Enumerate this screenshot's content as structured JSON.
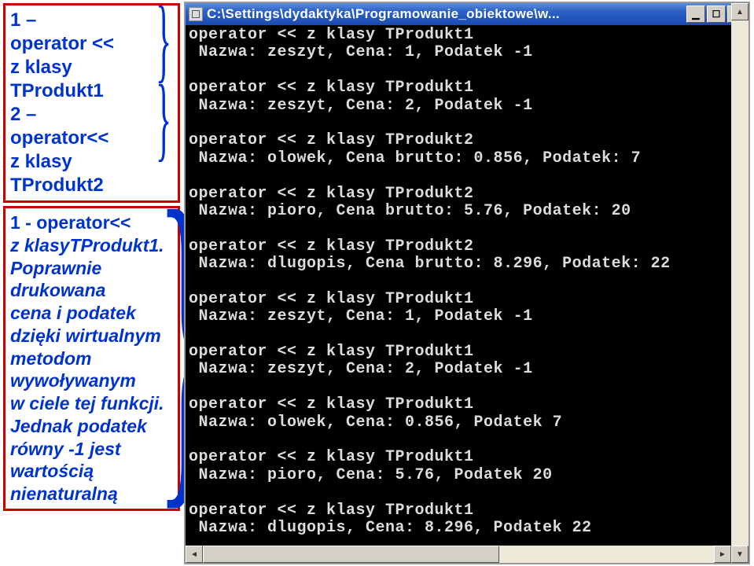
{
  "left": {
    "box1": {
      "l1": "1 –",
      "l2": "operator <<",
      "l3": "z klasy",
      "l4": "TProdukt1",
      "l5": "2 –",
      "l6": "operator<<",
      "l7": "z klasy",
      "l8": "TProdukt2"
    },
    "box2": {
      "l1": "1  - operator<<",
      "l2": "z klasyTProdukt1.",
      "l3": "Poprawnie",
      "l4": "drukowana",
      "l5": "cena i podatek",
      "l6": "dzięki wirtualnym",
      "l7": "metodom",
      "l8": "wywoływanym",
      "l9": "w ciele tej funkcji.",
      "l10": "Jednak podatek",
      "l11": "równy -1 jest",
      "l12": "wartością",
      "l13": "nienaturalną"
    }
  },
  "window": {
    "title": "C:\\Settings\\dydaktyka\\Programowanie_obiektowe\\w...",
    "buttons": {
      "min": "▁",
      "max": "☐",
      "close": "✕"
    }
  },
  "console": {
    "lines": [
      "operator << z klasy TProdukt1",
      " Nazwa: zeszyt, Cena: 1, Podatek -1",
      "",
      "operator << z klasy TProdukt1",
      " Nazwa: zeszyt, Cena: 2, Podatek -1",
      "",
      "operator << z klasy TProdukt2",
      " Nazwa: olowek, Cena brutto: 0.856, Podatek: 7",
      "",
      "operator << z klasy TProdukt2",
      " Nazwa: pioro, Cena brutto: 5.76, Podatek: 20",
      "",
      "operator << z klasy TProdukt2",
      " Nazwa: dlugopis, Cena brutto: 8.296, Podatek: 22",
      "",
      "operator << z klasy TProdukt1",
      " Nazwa: zeszyt, Cena: 1, Podatek -1",
      "",
      "operator << z klasy TProdukt1",
      " Nazwa: zeszyt, Cena: 2, Podatek -1",
      "",
      "operator << z klasy TProdukt1",
      " Nazwa: olowek, Cena: 0.856, Podatek 7",
      "",
      "operator << z klasy TProdukt1",
      " Nazwa: pioro, Cena: 5.76, Podatek 20",
      "",
      "operator << z klasy TProdukt1",
      " Nazwa: dlugopis, Cena: 8.296, Podatek 22"
    ]
  }
}
